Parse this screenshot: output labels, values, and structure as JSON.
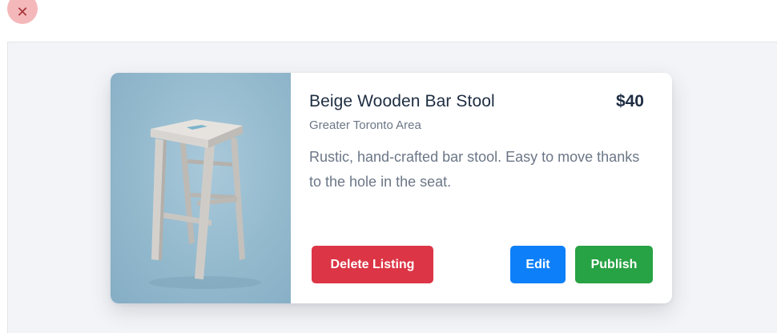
{
  "window": {
    "close_icon": "close-icon",
    "close_glyph": "✕"
  },
  "listing": {
    "image": "bar-stool-photo",
    "title": "Beige Wooden Bar Stool",
    "price": "$40",
    "location": "Greater Toronto Area",
    "description": "Rustic, hand-crafted bar stool. Easy to move thanks to the hole in the seat."
  },
  "actions": {
    "delete_label": "Delete Listing",
    "edit_label": "Edit",
    "publish_label": "Publish"
  },
  "colors": {
    "delete": "#dc3545",
    "edit": "#0d7ff8",
    "publish": "#27a244",
    "close_bg": "#f5b8ba",
    "stage_bg": "#f3f4f7",
    "text_primary": "#1e2d42",
    "text_secondary": "#6b7686"
  }
}
